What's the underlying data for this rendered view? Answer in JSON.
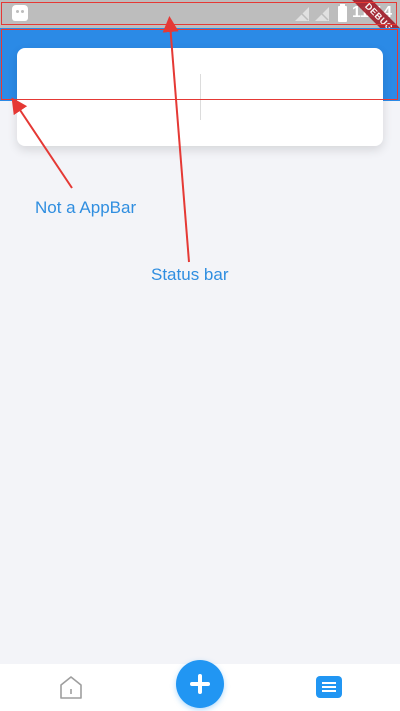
{
  "status_bar": {
    "time": "11:14",
    "left_icon": "android-notification-icon",
    "signal_icons": [
      "no-signal-icon",
      "no-signal-icon"
    ],
    "battery_icon": "battery-charging-icon"
  },
  "debug_banner": {
    "label": "DEBUG"
  },
  "annotations": {
    "appbar_label": "Not a AppBar",
    "status_label": "Status bar"
  },
  "colors": {
    "header": "#2b8ae6",
    "annotation": "#e53935",
    "accent": "#2196f3"
  },
  "bottom_nav": {
    "items": [
      {
        "icon": "home-icon"
      },
      {
        "icon": "add-icon"
      },
      {
        "icon": "list-icon"
      }
    ]
  }
}
